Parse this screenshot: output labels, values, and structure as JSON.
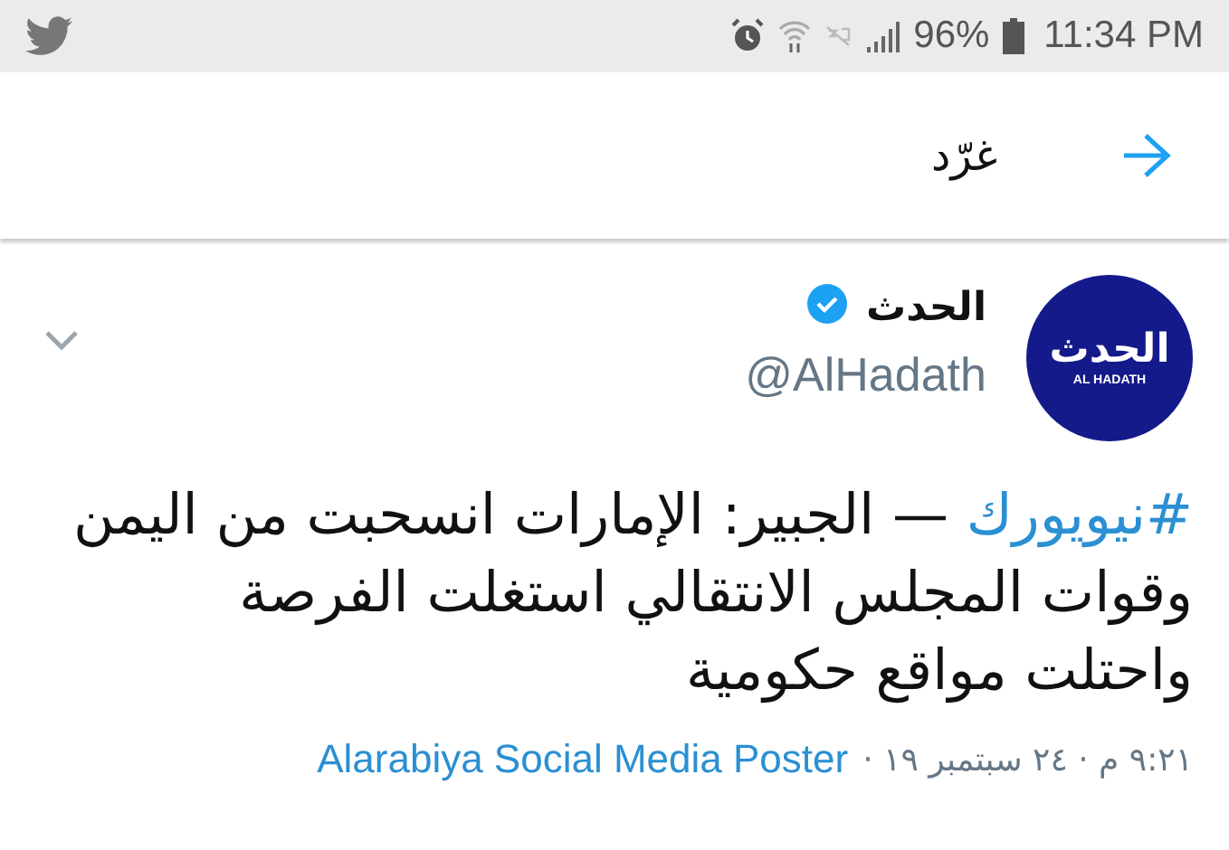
{
  "status_bar": {
    "battery": "96%",
    "time": "11:34 PM"
  },
  "header": {
    "title": "غرّد"
  },
  "tweet": {
    "avatar": {
      "logo_text": "الحدث",
      "logo_subtext": "AL HADATH"
    },
    "name": "الحدث",
    "verified": true,
    "handle": "@AlHadath",
    "hashtag": "#نيويورك",
    "text": "— الجبير: الإمارات انسحبت من اليمن وقوات المجلس الانتقالي استغلت الفرصة واحتلت مواقع حكومية",
    "meta": "٩:٢١ م · ٢٤ سبتمبر ١٩ ·",
    "source": "Alarabiya Social Media Poster"
  }
}
